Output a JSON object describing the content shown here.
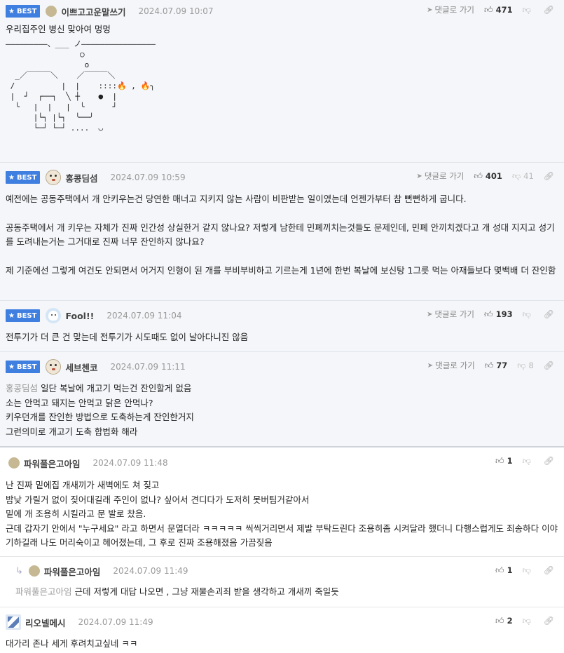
{
  "comments": [
    {
      "badge": "BEST",
      "nick": "이쁘고고운말쓰기",
      "date": "2024.07.09 10:07",
      "reply": "댓글로 가기",
      "up": "471",
      "lines": [
        "우리집주인 병신 맞아여 멍멍"
      ]
    },
    {
      "badge": "BEST",
      "nick": "홍콩딤섬",
      "date": "2024.07.09 10:59",
      "reply": "댓글로 가기",
      "up": "401",
      "down": "41",
      "lines": [
        "예전에는 공동주택에서 개 안키우는건 당연한 매너고 지키지 않는 사람이 비판받는 일이였는데 언젠가부터 참 뻔뻔하게 굽니다.",
        "",
        "공동주택에서 개 키우는 자체가 진짜 인간성 상실한거 같지 않나요? 저렇게 남한테 민폐끼치는것들도 문제인데, 민폐 안끼치겠다고 개 성대 지지고 성기를 도려내는거는 그거대로 진짜 너무 잔인하지 않나요?",
        "",
        "제 기준에선 그렇게 여건도 안되면서 어거지 인형이 된 개를 부비부비하고 기르는게 1년에 한번 복날에 보신탕 1그릇 먹는 아재들보다 몇백배 더 잔인함"
      ]
    },
    {
      "badge": "BEST",
      "nick": "Fool!!",
      "date": "2024.07.09 11:04",
      "reply": "댓글로 가기",
      "up": "193",
      "lines": [
        "전투기가 더 큰 건 맞는데 전투기가 시도때도 없이 날아다니진 않음"
      ]
    },
    {
      "badge": "BEST",
      "nick": "세브첸코",
      "date": "2024.07.09 11:11",
      "reply": "댓글로 가기",
      "up": "77",
      "down": "8",
      "mention": "홍콩딤섬",
      "lines": [
        "일단 복날에 개고기 먹는건 잔인할게 없음",
        "소는 안먹고 돼지는 안먹고 닭은 안먹나?",
        "키우던개를 잔인한 방법으로 도축하는게 잔인한거지",
        "그런의미로 개고기 도축 합법화 해라"
      ]
    },
    {
      "nick": "파워풀은고아임",
      "date": "2024.07.09 11:48",
      "up": "1",
      "lines": [
        "난 진짜 밑에집 개새끼가 새벽에도 쳐 짖고",
        "밤낮 가릴거 없이 짖어대길래 주인이 없나? 싶어서 견디다가 도저히 못버팀거같아서",
        "밑에 개 조용히 시킬라고 문 발로 찼음.",
        "근데 갑자기 안에서 \"누구세요\" 라고 하면서 문열더라 ㅋㅋㅋㅋㅋ 씩씩거리면서 제발 부탁드린다 조용히좀 시켜달라 했더니 다행스럽게도 죄송하다 이야기하길래 나도 머리숙이고 헤어졌는데, 그 후로 진짜 조용해졌음 가끔짖음"
      ]
    },
    {
      "nick": "파워풀은고아임",
      "date": "2024.07.09 11:49",
      "up": "1",
      "mention": "파워풀은고아임",
      "lines": [
        "근데 저렇게 대답 나오면 , 그냥 재물손괴죄 받을 생각하고 개새끼 죽일듯"
      ]
    },
    {
      "nick": "리오넬메시",
      "date": "2024.07.09 11:49",
      "up": "2",
      "lines": [
        "대가리 존나 세게 후려치고싶네 ㅋㅋ"
      ]
    }
  ],
  "ascii": [
    "―――――――――、___ ノ――――――――――――――――",
    "",
    "                ○",
    "",
    "                 o",
    "",
    "  _／￣￣￣＼    ／￣￣￣＼",
    " /          |  |    ::::🔥 , 🔥╮",
    " |  ┘  ┌──┐  ╲ ┼    ●  |",
    "  ╰   |  |   |  ╰      ┘",
    "      |└┐ |└┐  ╰──╯",
    "      └─┘ └─┘ ....  ◡"
  ]
}
